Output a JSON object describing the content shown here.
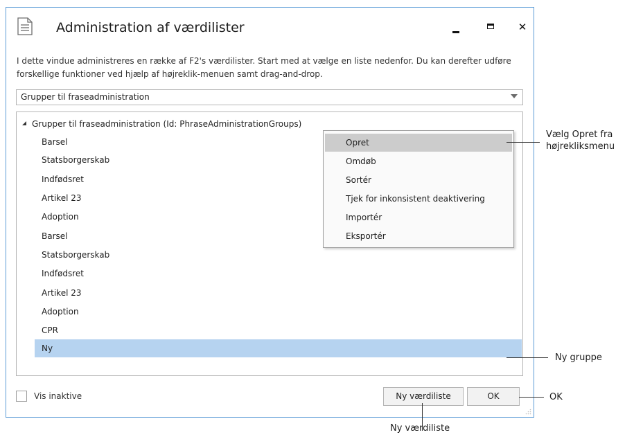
{
  "window": {
    "title": "Administration af værdilister",
    "minimize_symbol": "",
    "maximize_symbol": "",
    "close_symbol": "✕"
  },
  "description": "I dette vindue administreres en række af F2's værdilister. Start med at vælge en liste nedenfor. Du kan derefter udføre forskellige funktioner ved hjælp af højreklik-menuen samt drag-and-drop.",
  "list_selector": {
    "selected": "Grupper til fraseadministration"
  },
  "tree": {
    "root_label": "Grupper til fraseadministration (Id: PhraseAdministrationGroups)",
    "items": [
      {
        "label": "Barsel"
      },
      {
        "label": "Statsborgerskab"
      },
      {
        "label": "Indfødsret"
      },
      {
        "label": "Artikel 23"
      },
      {
        "label": "Adoption"
      },
      {
        "label": "Barsel"
      },
      {
        "label": "Statsborgerskab"
      },
      {
        "label": "Indfødsret"
      },
      {
        "label": "Artikel 23"
      },
      {
        "label": "Adoption"
      },
      {
        "label": "CPR"
      },
      {
        "label": "Ny",
        "selected": true
      }
    ]
  },
  "context_menu": {
    "items": [
      {
        "label": "Opret",
        "highlighted": true
      },
      {
        "label": "Omdøb"
      },
      {
        "label": "Sortér"
      },
      {
        "label": "Tjek for inkonsistent deaktivering"
      },
      {
        "label": "Importér"
      },
      {
        "label": "Eksportér"
      }
    ]
  },
  "footer": {
    "show_inactive_label": "Vis inaktive",
    "show_inactive_checked": false,
    "new_list_button": "Ny værdiliste",
    "ok_button": "OK"
  },
  "annotations": {
    "context_menu_callout_line1": "Vælg Opret fra",
    "context_menu_callout_line2": "højrekliksmenu",
    "new_group_callout": "Ny gruppe",
    "ok_callout": "OK",
    "new_list_callout": "Ny værdiliste"
  },
  "colors": {
    "window_border": "#5a9bd6",
    "selection": "#b6d3f0",
    "menu_highlight": "#cccccc"
  }
}
